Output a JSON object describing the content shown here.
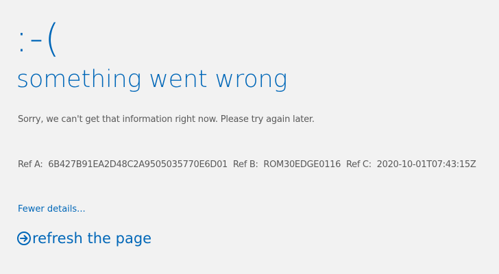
{
  "error": {
    "emoticon": ":-(",
    "headline": "something went wrong",
    "message": "Sorry, we can't get that information right now. Please try again later."
  },
  "refs": {
    "ref_a_label": "Ref A:",
    "ref_a_value": "6B427B91EA2D48C2A9505035770E6D01",
    "ref_b_label": "Ref B:",
    "ref_b_value": "ROM30EDGE0116",
    "ref_c_label": "Ref C:",
    "ref_c_value": "2020-10-01T07:43:15Z"
  },
  "actions": {
    "details_label": "Fewer details...",
    "refresh_label": "refresh the page",
    "refresh_icon": "circle-arrow-right-icon"
  },
  "colors": {
    "background": "#f2f2f2",
    "accent": "#0067b8",
    "body_text": "#595959"
  }
}
